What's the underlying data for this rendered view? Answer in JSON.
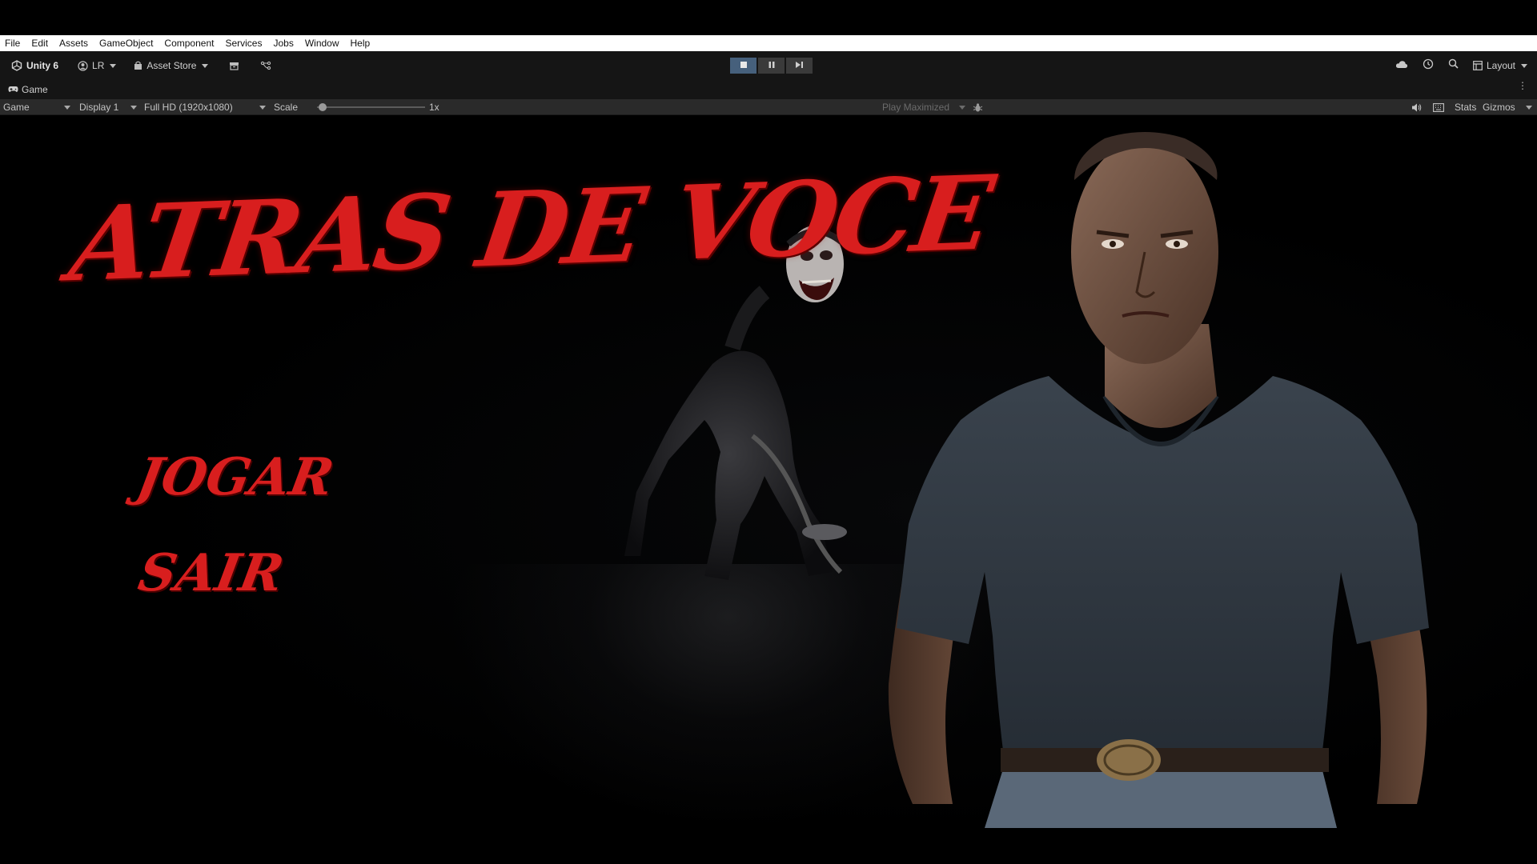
{
  "menubar": {
    "items": [
      "File",
      "Edit",
      "Assets",
      "GameObject",
      "Component",
      "Services",
      "Jobs",
      "Window",
      "Help"
    ]
  },
  "toolbar": {
    "unity_label": "Unity 6",
    "account_label": "LR",
    "asset_store_label": "Asset Store",
    "layout_label": "Layout"
  },
  "game_tab": {
    "label": "Game"
  },
  "game_view_bar": {
    "mode": "Game",
    "display": "Display 1",
    "resolution": "Full HD (1920x1080)",
    "scale_label": "Scale",
    "scale_value": "1x",
    "scale_fraction": 0.05,
    "play_maximized": "Play Maximized",
    "stats": "Stats",
    "gizmos": "Gizmos"
  },
  "game": {
    "title": "ATRAS DE VOCE",
    "jogar": "JOGAR",
    "sair": "SAIR",
    "accent_color": "#d81e1e"
  },
  "icons": {
    "unity_logo": "unity-logo-icon",
    "account": "account-icon",
    "asset_store": "asset-store-icon",
    "package": "package-icon",
    "version_control": "version-control-icon",
    "stop": "stop-icon",
    "pause": "pause-icon",
    "step": "step-icon",
    "cloud": "cloud-icon",
    "history": "history-icon",
    "search": "search-icon",
    "layout": "layout-icon",
    "gamepad": "gamepad-icon",
    "audio": "audio-icon",
    "keyboard": "keyboard-icon",
    "bug": "bug-icon"
  }
}
